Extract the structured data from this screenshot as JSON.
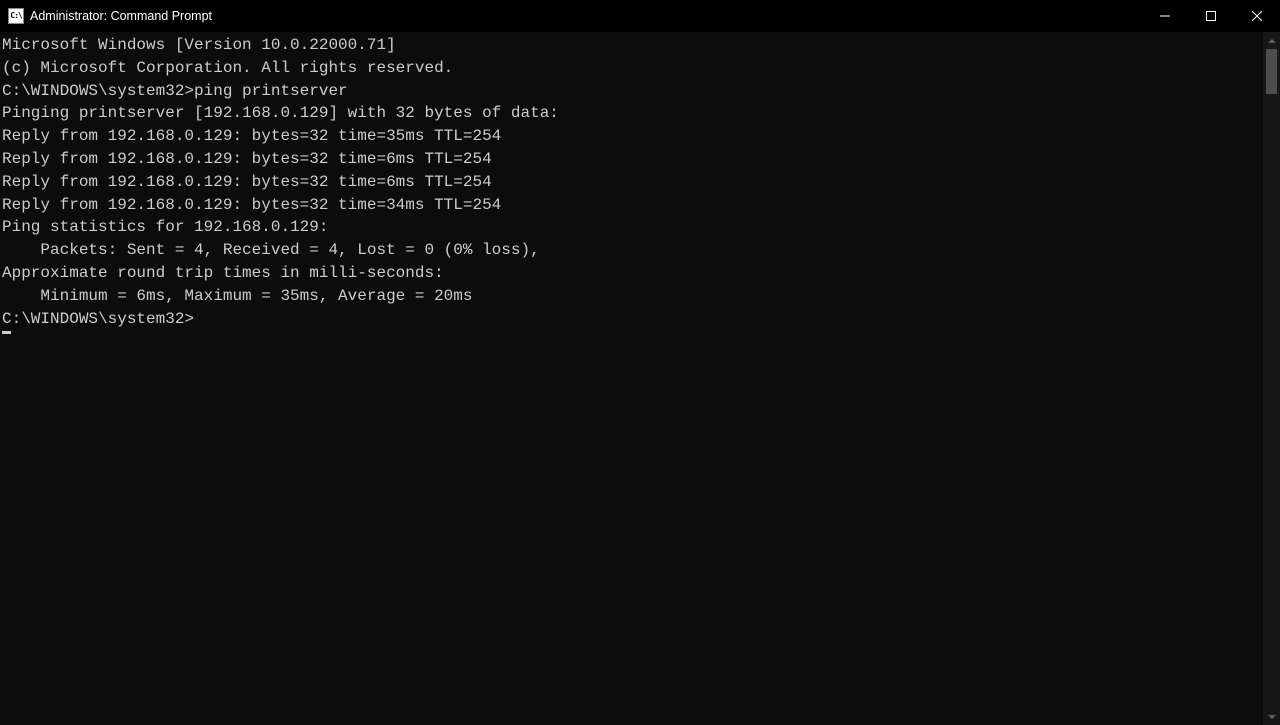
{
  "titlebar": {
    "icon_text": "C:\\",
    "title": "Administrator: Command Prompt"
  },
  "terminal": {
    "line1": "Microsoft Windows [Version 10.0.22000.71]",
    "line2": "(c) Microsoft Corporation. All rights reserved.",
    "blank1": "",
    "prompt1": "C:\\WINDOWS\\system32>ping printserver",
    "blank2": "",
    "pinging": "Pinging printserver [192.168.0.129] with 32 bytes of data:",
    "reply1": "Reply from 192.168.0.129: bytes=32 time=35ms TTL=254",
    "reply2": "Reply from 192.168.0.129: bytes=32 time=6ms TTL=254",
    "reply3": "Reply from 192.168.0.129: bytes=32 time=6ms TTL=254",
    "reply4": "Reply from 192.168.0.129: bytes=32 time=34ms TTL=254",
    "blank3": "",
    "stats_header": "Ping statistics for 192.168.0.129:",
    "packets": "    Packets: Sent = 4, Received = 4, Lost = 0 (0% loss),",
    "approx": "Approximate round trip times in milli-seconds:",
    "minmax": "    Minimum = 6ms, Maximum = 35ms, Average = 20ms",
    "blank4": "",
    "prompt2": "C:\\WINDOWS\\system32>"
  }
}
